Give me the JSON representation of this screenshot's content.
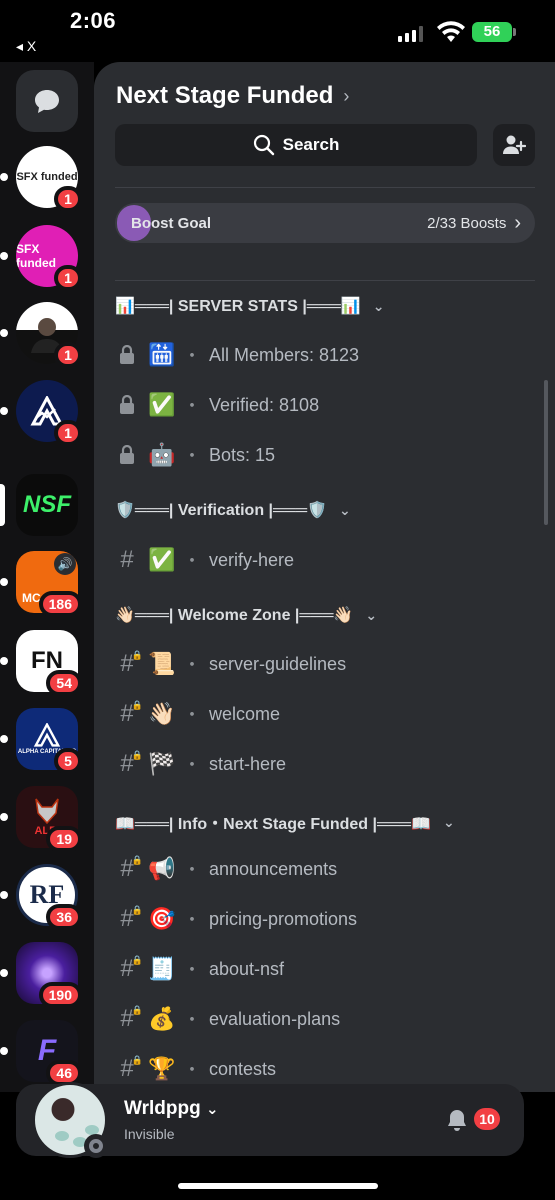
{
  "status_bar": {
    "time": "2:06",
    "back_app": "◂ X",
    "battery": "56"
  },
  "server_rail": {
    "servers": [
      {
        "label": "SFX funded",
        "badge": "1"
      },
      {
        "label": "SFX funded",
        "badge": "1"
      },
      {
        "label": "",
        "badge": "1"
      },
      {
        "label": "",
        "badge": "1"
      },
      {
        "label": "NSF",
        "badge": ""
      },
      {
        "label": "MC",
        "badge": "186"
      },
      {
        "label": "FN",
        "badge": "54"
      },
      {
        "label": "ALPHA CAPITAL GR",
        "badge": "5"
      },
      {
        "label": "ALPI",
        "badge": "19"
      },
      {
        "label": "RF",
        "badge": "36"
      },
      {
        "label": "",
        "badge": "190"
      },
      {
        "label": "F",
        "badge": "46"
      }
    ]
  },
  "header": {
    "server_name": "Next Stage Funded",
    "search_label": "Search"
  },
  "boost": {
    "label": "Boost Goal",
    "progress": "2/33 Boosts"
  },
  "categories": {
    "stats": "📊═══| SERVER STATS |═══📊",
    "verification": "🛡️═══| Verification |═══🛡️",
    "welcome": "👋🏻═══| Welcome Zone |═══👋🏻",
    "info": "📖═══| Info・Next Stage Funded |═══📖"
  },
  "channels": {
    "members": {
      "emoji": "🛗",
      "name": "All Members: 8123"
    },
    "verified": {
      "emoji": "✅",
      "name": "Verified: 8108"
    },
    "bots": {
      "emoji": "🤖",
      "name": "Bots: 15"
    },
    "verify": {
      "emoji": "✅",
      "name": "verify-here"
    },
    "guidelines": {
      "emoji": "📜",
      "name": "server-guidelines"
    },
    "welcome": {
      "emoji": "👋🏻",
      "name": "welcome"
    },
    "start": {
      "emoji": "🏁",
      "name": "start-here"
    },
    "announcements": {
      "emoji": "📢",
      "name": "announcements"
    },
    "pricing": {
      "emoji": "🎯",
      "name": "pricing-promotions"
    },
    "about": {
      "emoji": "🧾",
      "name": "about-nsf"
    },
    "evaluation": {
      "emoji": "💰",
      "name": "evaluation-plans"
    },
    "contests": {
      "emoji": "🏆",
      "name": "contests"
    }
  },
  "user": {
    "name": "Wrldppg",
    "status": "Invisible",
    "notifications": "10"
  }
}
